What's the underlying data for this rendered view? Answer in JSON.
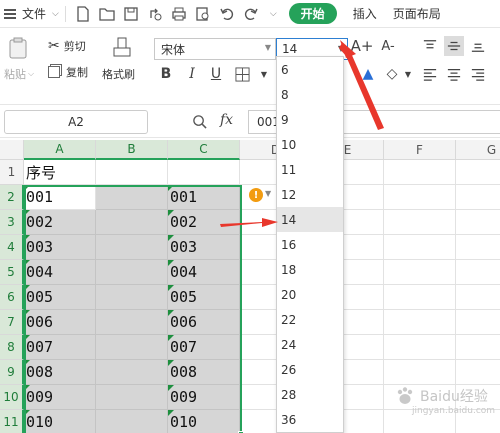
{
  "menubar": {
    "file_label": "文件",
    "tabs": [
      "开始",
      "插入",
      "页面布局"
    ]
  },
  "toolbar": {
    "paste_label": "粘贴",
    "cut_label": "剪切",
    "copy_label": "复制",
    "format_painter_label": "格式刷",
    "font_name": "宋体",
    "font_size": "14",
    "bold_label": "B",
    "italic_label": "I",
    "underline_label": "U",
    "grow_font_label": "A+",
    "shrink_font_label": "A-"
  },
  "formula_bar": {
    "name_box": "A2",
    "fx_label": "fx",
    "value": "001"
  },
  "columns": [
    "A",
    "B",
    "C",
    "D",
    "E",
    "F",
    "G"
  ],
  "rows": [
    "1",
    "2",
    "3",
    "4",
    "5",
    "6",
    "7",
    "8",
    "9",
    "10",
    "11"
  ],
  "cells_a": [
    "序号",
    "001",
    "002",
    "003",
    "004",
    "005",
    "006",
    "007",
    "008",
    "009",
    "010"
  ],
  "cells_c": [
    "",
    "001",
    "002",
    "003",
    "004",
    "005",
    "006",
    "007",
    "008",
    "009",
    "010"
  ],
  "warning_icon": "!",
  "font_size_options": [
    "6",
    "8",
    "9",
    "10",
    "11",
    "12",
    "14",
    "16",
    "18",
    "20",
    "22",
    "24",
    "26",
    "28",
    "36"
  ],
  "selected_font_size": "14",
  "colors": {
    "accent": "#25a25a",
    "arrow": "#e8372c"
  },
  "watermark": {
    "main": "Baidu经验",
    "sub": "jingyan.baidu.com"
  }
}
